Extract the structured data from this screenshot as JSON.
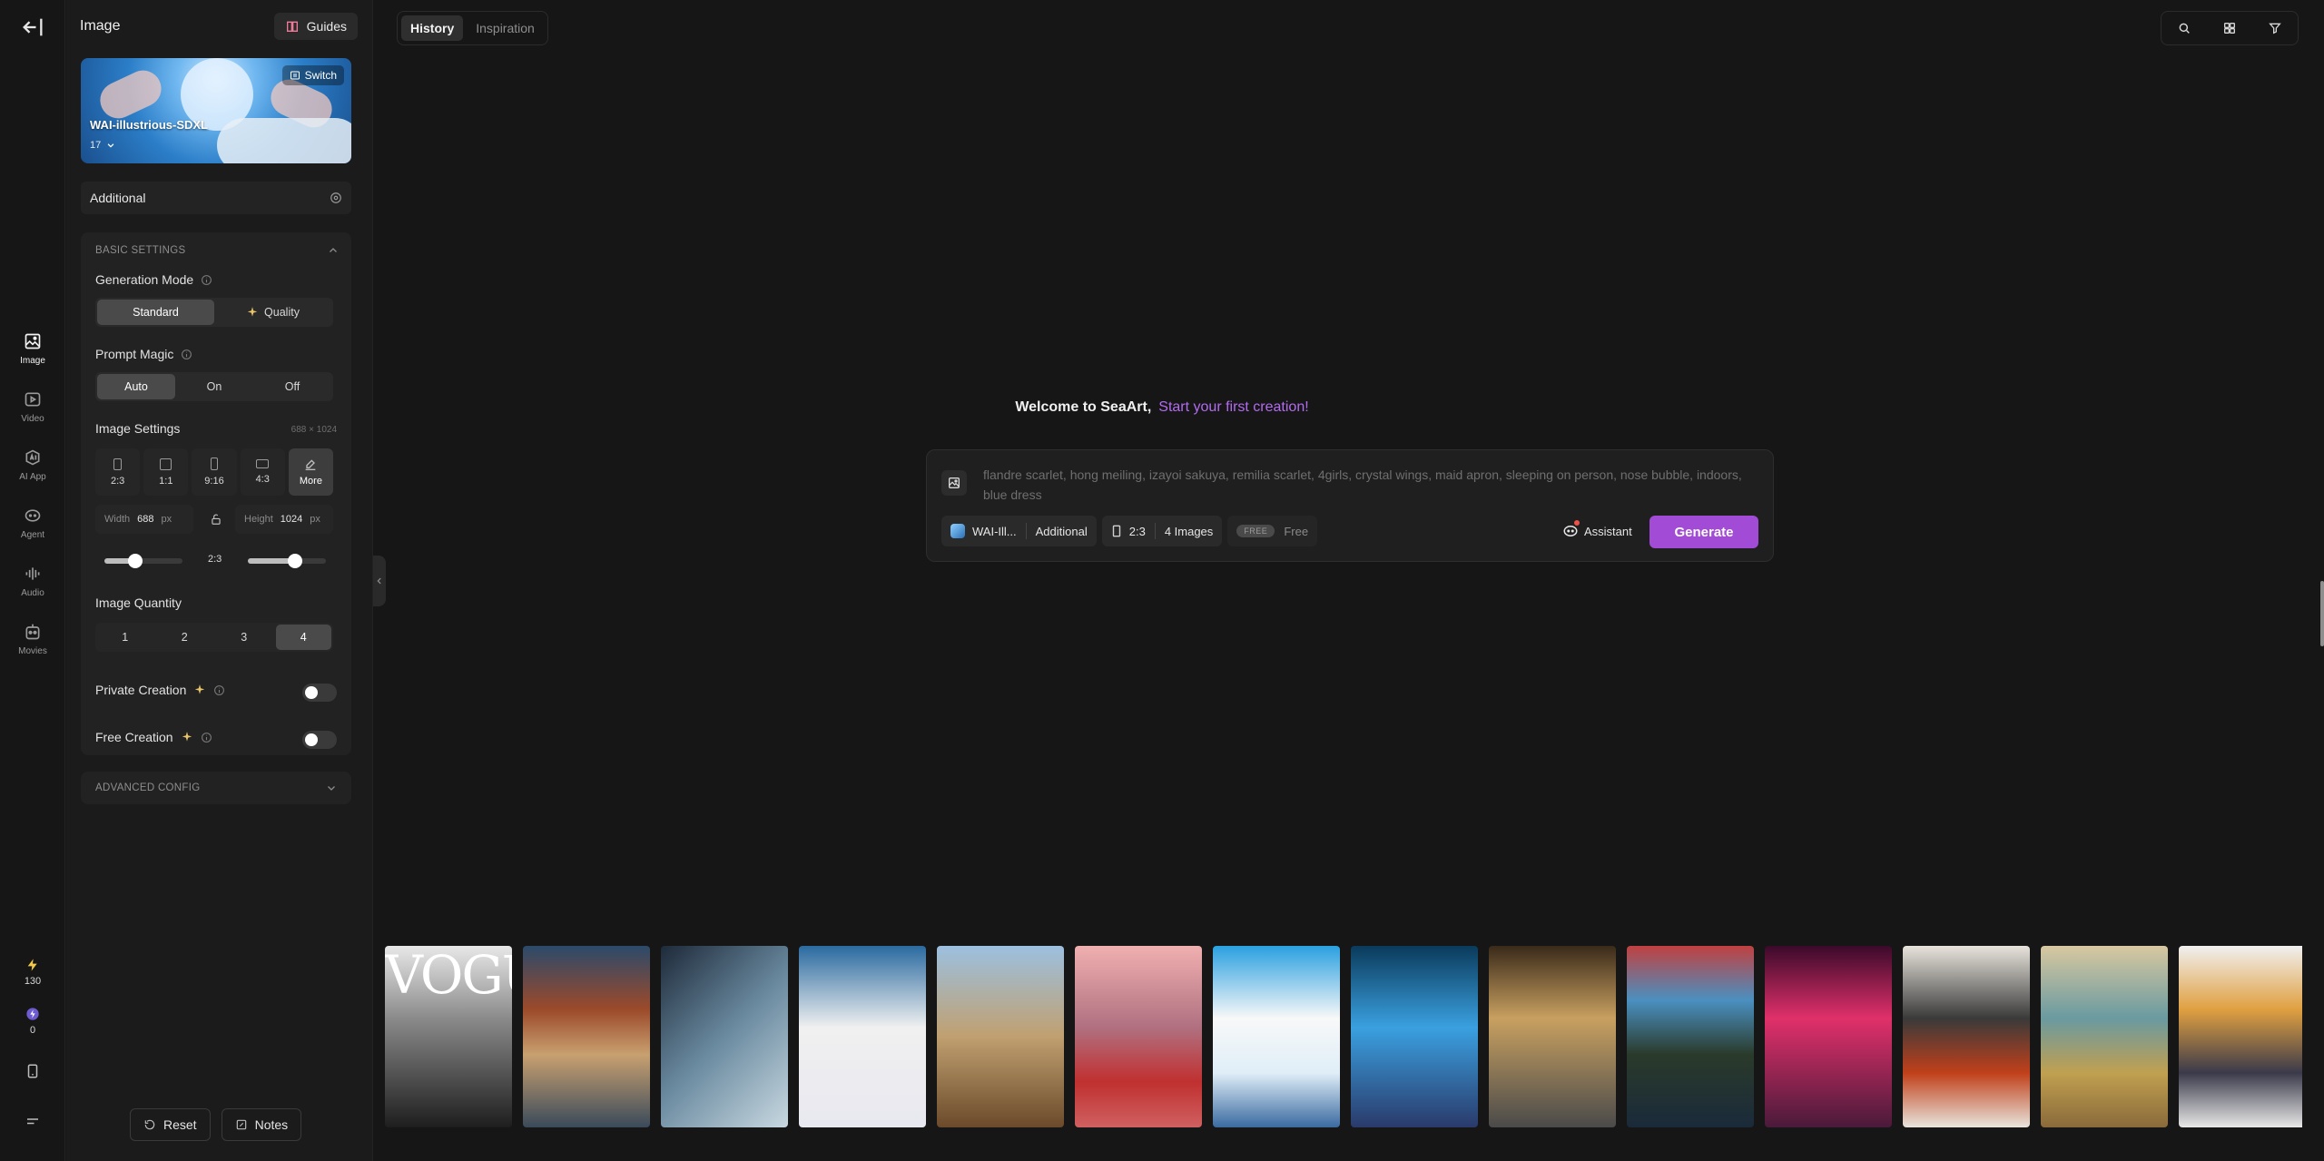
{
  "rail": {
    "items": [
      {
        "label": "Image",
        "icon": "image-icon",
        "active": true
      },
      {
        "label": "Video",
        "icon": "video-icon",
        "active": false
      },
      {
        "label": "AI App",
        "icon": "ai-app-icon",
        "active": false
      },
      {
        "label": "Agent",
        "icon": "agent-icon",
        "active": false
      },
      {
        "label": "Audio",
        "icon": "audio-icon",
        "active": false
      },
      {
        "label": "Movies",
        "icon": "movies-icon",
        "active": false
      }
    ],
    "stamina": "130",
    "energy": "0"
  },
  "panel": {
    "title": "Image",
    "guides_label": "Guides",
    "model": {
      "name": "WAI-illustrious-SDXL",
      "version": "17",
      "switch_label": "Switch"
    },
    "additional_label": "Additional",
    "basic_settings": {
      "heading": "BASIC SETTINGS",
      "generation_mode": {
        "label": "Generation Mode",
        "options": [
          "Standard",
          "Quality"
        ],
        "selected": "Standard"
      },
      "prompt_magic": {
        "label": "Prompt Magic",
        "options": [
          "Auto",
          "On",
          "Off"
        ],
        "selected": "Auto"
      },
      "image_settings": {
        "label": "Image Settings",
        "dimensions": "688 × 1024",
        "ratios": [
          "2:3",
          "1:1",
          "9:16",
          "4:3",
          "More"
        ],
        "selected": "More",
        "width_label": "Width",
        "width_value": "688",
        "unit": "px",
        "height_label": "Height",
        "height_value": "1024",
        "ratio_value": "2:3",
        "width_slider_fraction": 0.4,
        "height_slider_fraction": 0.6
      },
      "image_quantity": {
        "label": "Image Quantity",
        "options": [
          "1",
          "2",
          "3",
          "4"
        ],
        "selected": "4"
      },
      "private_creation": {
        "label": "Private Creation",
        "enabled": false
      },
      "free_creation": {
        "label": "Free Creation",
        "enabled": false
      }
    },
    "advanced_heading": "ADVANCED CONFIG",
    "reset_label": "Reset",
    "notes_label": "Notes"
  },
  "main": {
    "tabs": [
      "History",
      "Inspiration"
    ],
    "active_tab": "History",
    "welcome": "Welcome to SeaArt,",
    "welcome_accent": "Start your first creation!",
    "prompt_placeholder": "flandre scarlet, hong meiling, izayoi sakuya, remilia scarlet, 4girls, crystal wings, maid apron, sleeping on person, nose bubble, indoors, blue dress",
    "chip_model": "WAI-Ill...",
    "chip_additional": "Additional",
    "chip_ratio": "2:3",
    "chip_images": "4 Images",
    "chip_free_badge": "FREE",
    "chip_free": "Free",
    "assistant_label": "Assistant",
    "generate_label": "Generate",
    "accent_color": "#a24bd6",
    "gallery_vogue": "VOGUE"
  }
}
